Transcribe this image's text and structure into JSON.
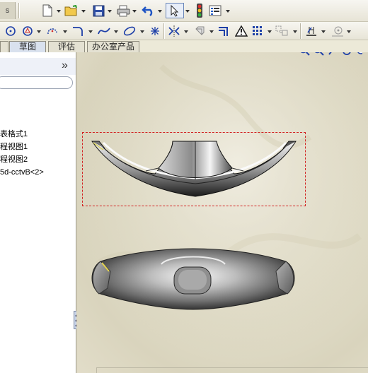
{
  "app": {
    "label": "s"
  },
  "toolbar": {
    "row1": [
      "new-doc-icon",
      "open-folder-icon",
      "save-icon",
      "print-icon",
      "undo-icon",
      "select-pointer-icon",
      "traffic-light-icon",
      "options-list-icon"
    ],
    "row2": [
      "circle-icon",
      "polygon-circle-icon",
      "arc-icon",
      "fillet-icon",
      "spline-icon",
      "ellipse-icon",
      "point-icon",
      "mirror-icon",
      "offset-icon",
      "trim-icon",
      "warning-icon",
      "grid-icon",
      "block-icon",
      "dimension-icon",
      "snap-icon"
    ]
  },
  "tabs": [
    {
      "label": "草图",
      "active": true
    },
    {
      "label": "评估",
      "active": false
    },
    {
      "label": "办公室产品",
      "active": false
    }
  ],
  "left_panel": {
    "collapse_glyph": "»",
    "tree_items": [
      "表格式1",
      "程视图1",
      "程视图2",
      "5d-cctvB<2>"
    ]
  },
  "hud_icons": [
    "zoom-fit-icon",
    "zoom-area-icon",
    "previous-view-icon",
    "rotate-icon",
    "pan-icon"
  ],
  "colors": {
    "selection_frame": "#d22222",
    "tab_active": "#d9e1ee"
  }
}
